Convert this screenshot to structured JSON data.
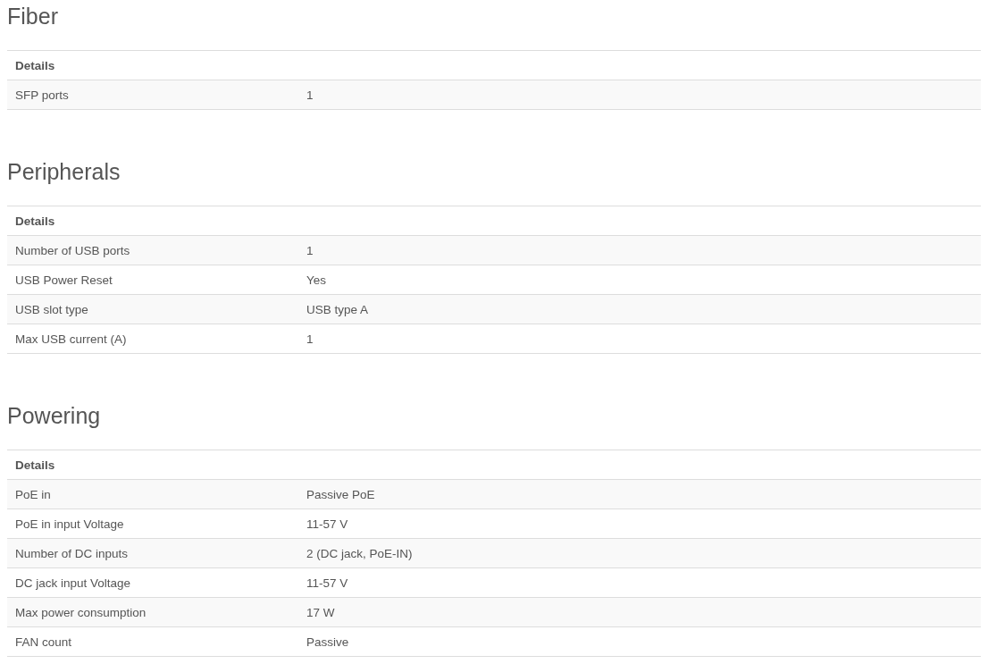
{
  "sections": [
    {
      "title": "Fiber",
      "header": "Details",
      "rows": [
        {
          "label": "SFP ports",
          "value": "1"
        }
      ]
    },
    {
      "title": "Peripherals",
      "header": "Details",
      "rows": [
        {
          "label": "Number of USB ports",
          "value": "1"
        },
        {
          "label": "USB Power Reset",
          "value": "Yes"
        },
        {
          "label": "USB slot type",
          "value": "USB type A"
        },
        {
          "label": "Max USB current (A)",
          "value": "1"
        }
      ]
    },
    {
      "title": "Powering",
      "header": "Details",
      "rows": [
        {
          "label": "PoE in",
          "value": "Passive PoE"
        },
        {
          "label": "PoE in input Voltage",
          "value": "11-57 V"
        },
        {
          "label": "Number of DC inputs",
          "value": "2 (DC jack, PoE-IN)"
        },
        {
          "label": "DC jack input Voltage",
          "value": "11-57 V"
        },
        {
          "label": "Max power consumption",
          "value": "17 W"
        },
        {
          "label": "FAN count",
          "value": "Passive"
        }
      ]
    }
  ]
}
